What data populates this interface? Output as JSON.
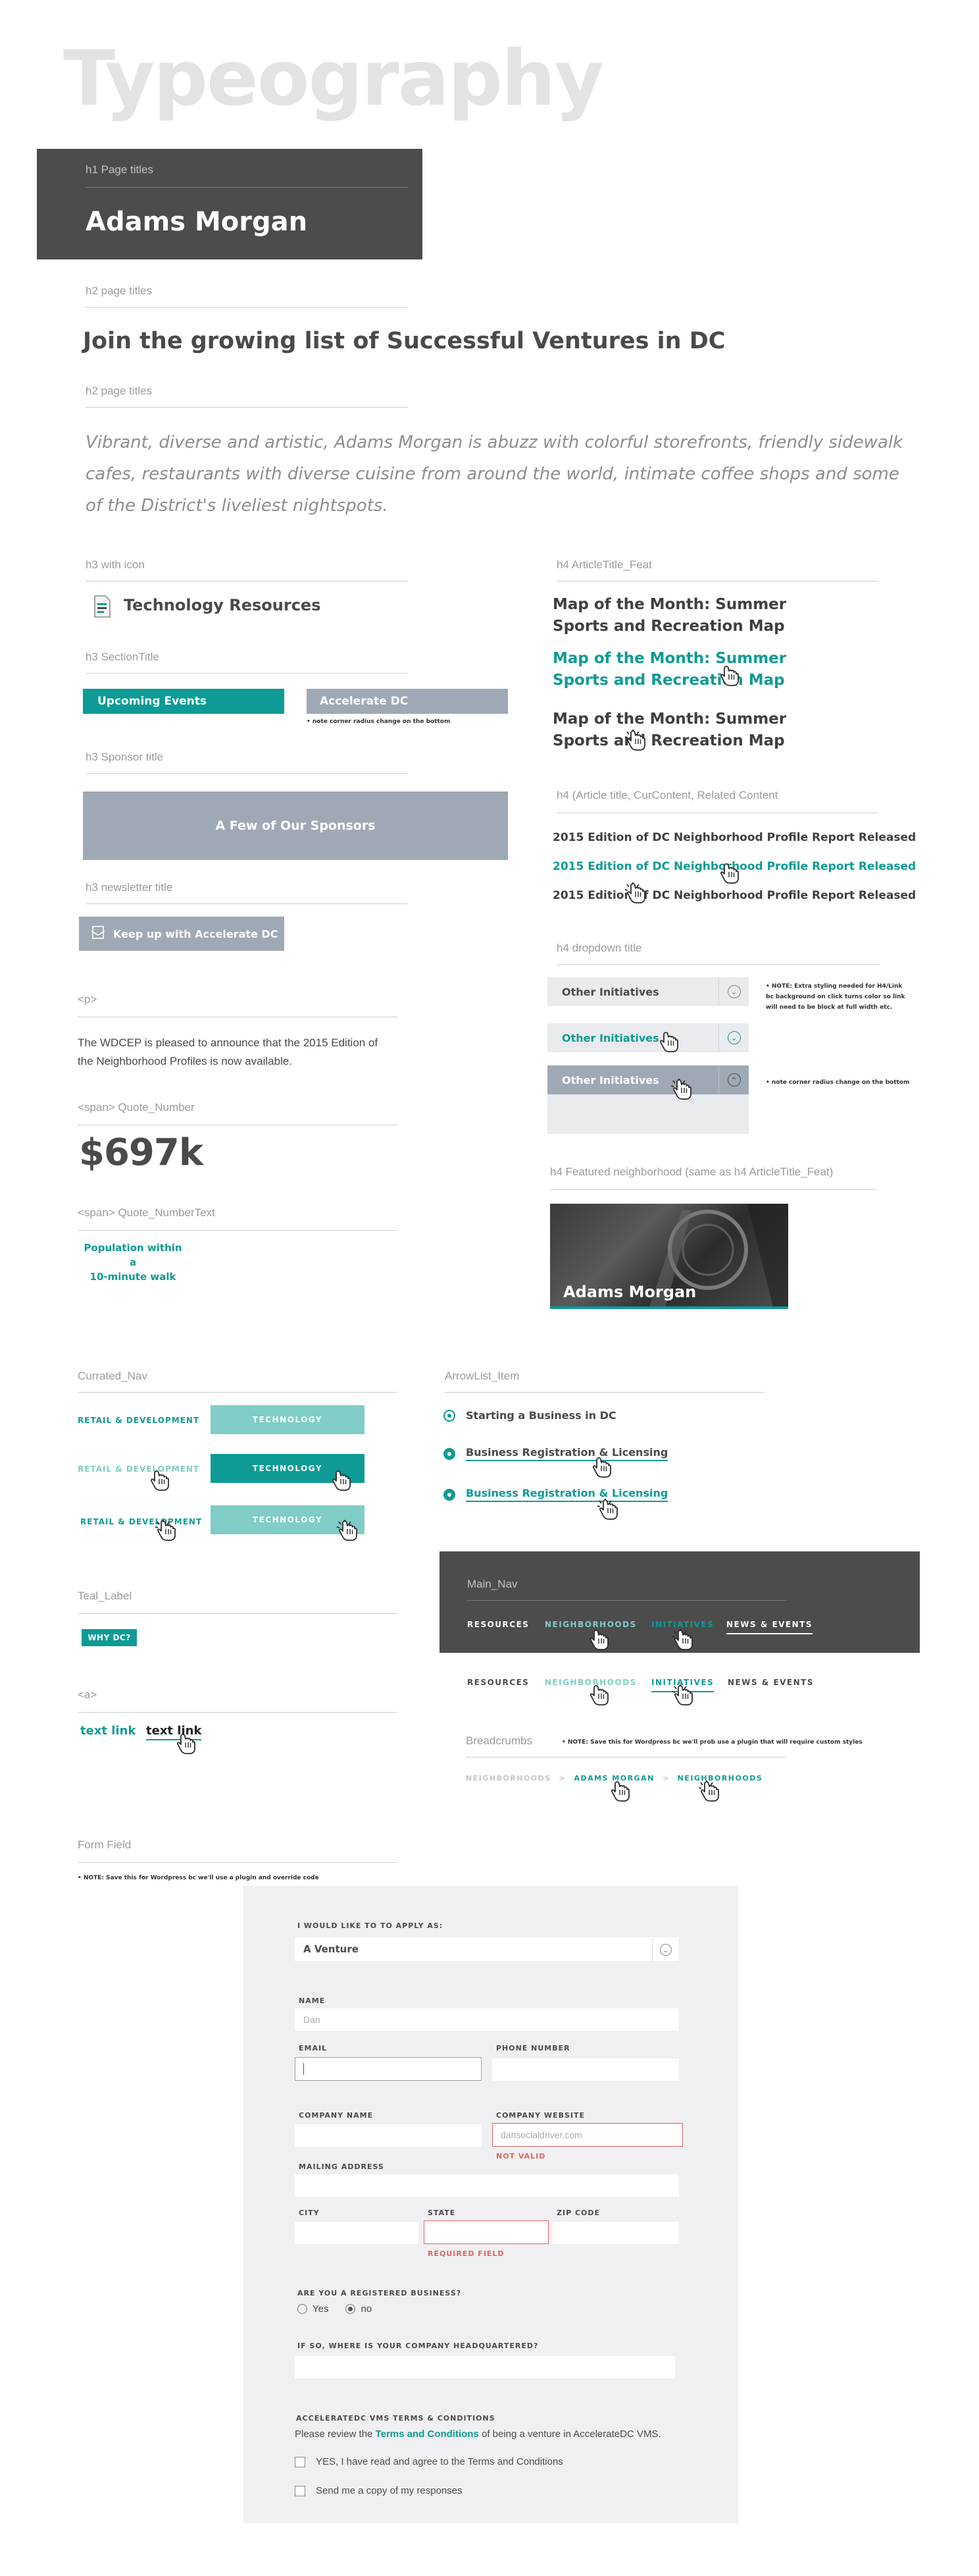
{
  "page": {
    "title": "Typeography"
  },
  "h1": {
    "label": "h1 Page titles",
    "text": "Adams Morgan"
  },
  "h2": {
    "label": "h2 page titles",
    "text": "Join the growing list of Successful Ventures in DC",
    "label2": "h2 page titles",
    "intro_lines": [
      "Vibrant, diverse and artistic, Adams Morgan is abuzz with colorful storefronts, friendly sidewalk",
      "cafes, restaurants with diverse cuisine from around the world, intimate coffee shops and some",
      "of the District's liveliest nightspots."
    ]
  },
  "h3": {
    "icon_label": "h3 with icon",
    "icon_text": "Technology Resources",
    "section_label": "h3  SectionTitle",
    "section_btn1": "Upcoming Events",
    "section_btn2": "Accelerate DC",
    "section_note": "• note corner radius change on the bottom",
    "sponsor_label": "h3  Sponsor title",
    "sponsor_text": "A Few of Our Sponsors",
    "newsletter_label": "h3 newsletter title",
    "newsletter_text": "Keep up with Accelerate DC"
  },
  "p": {
    "label": "<p>",
    "lines": [
      "The WDCEP is pleased to announce that the 2015 Edition of",
      "the Neighborhood Profiles is now available."
    ]
  },
  "quote": {
    "label": "<span>  Quote_Number",
    "value": "$697k",
    "text_label": "<span>  Quote_NumberText",
    "text_lines": [
      "Population within a",
      "10-minute walk"
    ]
  },
  "h4_feat": {
    "label": "h4 ArticleTitle_Feat",
    "items": [
      [
        "Map of the Month: Summer",
        "Sports and Recreation Map"
      ],
      [
        "Map of the Month: Summer",
        "Sports and Recreation Map"
      ],
      [
        "Map of the Month: Summer",
        "Sports and Recreation Map"
      ]
    ]
  },
  "h4_article": {
    "label": "h4 (Article title, CurContent, Related Content",
    "items": [
      "2015 Edition of DC Neighborhood Profile Report Released",
      "2015 Edition of DC Neighborhood Profile Report Released",
      "2015 Edition of DC Neighborhood Profile Report Released"
    ]
  },
  "h4_dropdown": {
    "label": "h4 dropdown title",
    "items": [
      "Other Initiatives",
      "Other Initiatives",
      "Other Initiatives"
    ],
    "note1_lines": [
      "• NOTE: Extra styling needed for H4/Link",
      "bc background on click turns color so link",
      "will need to be block at full width etc."
    ],
    "note2": "• note corner radius change on the bottom"
  },
  "h4_featured_neighborhood": {
    "label": "h4 Featured neighborhood (same as h4 ArticleTitle_Feat)",
    "title": "Adams Morgan"
  },
  "currated_nav": {
    "label": "Currated_Nav",
    "rows": [
      {
        "left": "RETAIL & DEVELOPMENT",
        "right": "TECHNOLOGY"
      },
      {
        "left": "RETAIL & DEVELOPMENT",
        "right": "TECHNOLOGY"
      },
      {
        "left": "RETAIL & DEVELOPMENT",
        "right": "TECHNOLOGY"
      }
    ]
  },
  "arrow_list": {
    "label": "ArrowList_Item",
    "items": [
      "Starting a Business in DC",
      "Business Registration & Licensing",
      "Business Registration & Licensing"
    ]
  },
  "main_nav": {
    "label": "Main_Nav",
    "items": [
      "RESOURCES",
      "NEIGHBORHOODS",
      "INITIATIVES",
      "NEWS & EVENTS"
    ],
    "items_light": [
      "RESOURCES",
      "NEIGHBORHOODS",
      "INITIATIVES",
      "NEWS & EVENTS"
    ]
  },
  "breadcrumbs": {
    "label": "Breadcrumbs",
    "note": "• NOTE: Save this for Wordpress bc we'll prob use a plugin that will require custom styles",
    "items": [
      "NEIGHBORHOODS",
      ">",
      "ADAMS MORGAN",
      ">",
      "NEIGHBORHOODS"
    ]
  },
  "teal_label": {
    "label": "Teal_Label",
    "text": "WHY DC?"
  },
  "a": {
    "label": "<a>",
    "link1": "text link",
    "link2": "text link"
  },
  "form": {
    "label": "Form Field",
    "note": "• NOTE: Save this for Wordpress bc we'll use a plugin and override code",
    "apply_label": "I WOULD LIKE TO TO APPLY AS:",
    "apply_value": "A Venture",
    "name_label": "NAME",
    "name_value": "Dan",
    "email_label": "EMAIL",
    "phone_label": "PHONE NUMBER",
    "company_label": "COMPANY NAME",
    "website_label": "COMPANY WEBSITE",
    "website_value": "dansocialdriver.com",
    "website_error": "NOT VALID",
    "mailing_label": "MAILING ADDRESS",
    "city_label": "CITY",
    "state_label": "STATE",
    "zip_label": "ZIP CODE",
    "state_error": "REQUIRED FIELD",
    "registered_label": "ARE YOU A REGISTERED BUSINESS?",
    "yes": "Yes",
    "no": "no",
    "hq_label": "IF SO, WHERE IS YOUR COMPANY HEADQUARTERED?",
    "terms_label": "ACCELERATEDC VMS TERMS & CONDITIONS",
    "terms_pre": "Please review the ",
    "terms_link": "Terms and Conditions",
    "terms_post": " of being a venture in AccelerateDC VMS.",
    "check1": "YES, I have read and agree to the Terms and Conditions",
    "check2": "Send me a copy of my responses"
  },
  "colors": {
    "teal": "#0e9b95",
    "teal_light": "#7fcdc6",
    "grey_dark": "#4c4c4c",
    "slate": "#9fa9b5",
    "error": "#e4625f"
  }
}
